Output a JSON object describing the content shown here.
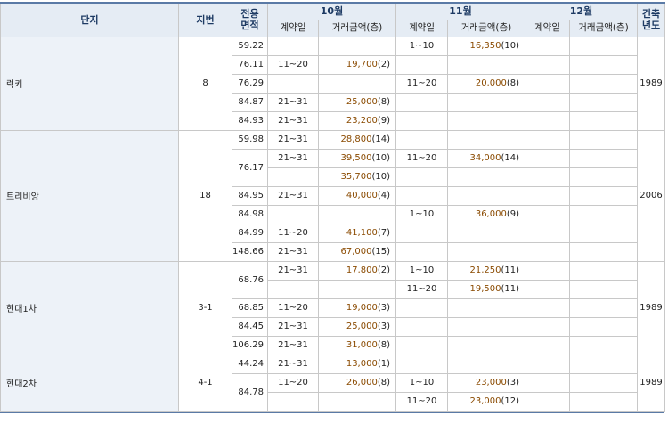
{
  "header": {
    "danji": "단지",
    "jibun": "지번",
    "area_l1": "전용",
    "area_l2": "면적",
    "months": [
      "10월",
      "11월",
      "12월"
    ],
    "built_l1": "건축",
    "built_l2": "년도",
    "contract_day": "계약일",
    "amount": "거래금액(층)"
  },
  "groups": [
    {
      "name": "럭키",
      "jibun": "8",
      "year": "1989",
      "rows": [
        {
          "area": "59.22",
          "m10d": "",
          "m10v": "",
          "m10c": "",
          "m11d": "1~10",
          "m11v": "16,350",
          "m11c": "(10)",
          "m12d": "",
          "m12v": "",
          "m12c": ""
        },
        {
          "area": "76.11",
          "m10d": "11~20",
          "m10v": "19,700",
          "m10c": "(2)",
          "m11d": "",
          "m11v": "",
          "m11c": "",
          "m12d": "",
          "m12v": "",
          "m12c": ""
        },
        {
          "area": "76.29",
          "m10d": "",
          "m10v": "",
          "m10c": "",
          "m11d": "11~20",
          "m11v": "20,000",
          "m11c": "(8)",
          "m12d": "",
          "m12v": "",
          "m12c": ""
        },
        {
          "area": "84.87",
          "m10d": "21~31",
          "m10v": "25,000",
          "m10c": "(8)",
          "m11d": "",
          "m11v": "",
          "m11c": "",
          "m12d": "",
          "m12v": "",
          "m12c": ""
        },
        {
          "area": "84.93",
          "m10d": "21~31",
          "m10v": "23,200",
          "m10c": "(9)",
          "m11d": "",
          "m11v": "",
          "m11c": "",
          "m12d": "",
          "m12v": "",
          "m12c": ""
        }
      ]
    },
    {
      "name": "트리비앙",
      "jibun": "18",
      "year": "2006",
      "rows": [
        {
          "area": "59.98",
          "m10d": "21~31",
          "m10v": "28,800",
          "m10c": "(14)",
          "m11d": "",
          "m11v": "",
          "m11c": "",
          "m12d": "",
          "m12v": "",
          "m12c": ""
        },
        {
          "area": "76.17",
          "m10d": "21~31",
          "m10v": "39,500",
          "m10c": "(10)",
          "m11d": "11~20",
          "m11v": "34,000",
          "m11c": "(14)",
          "m12d": "",
          "m12v": "",
          "m12c": ""
        },
        {
          "area": "",
          "m10d": "",
          "m10v": "35,700",
          "m10c": "(10)",
          "m11d": "",
          "m11v": "",
          "m11c": "",
          "m12d": "",
          "m12v": "",
          "m12c": ""
        },
        {
          "area": "84.95",
          "m10d": "21~31",
          "m10v": "40,000",
          "m10c": "(4)",
          "m11d": "",
          "m11v": "",
          "m11c": "",
          "m12d": "",
          "m12v": "",
          "m12c": ""
        },
        {
          "area": "84.98",
          "m10d": "",
          "m10v": "",
          "m10c": "",
          "m11d": "1~10",
          "m11v": "36,000",
          "m11c": "(9)",
          "m12d": "",
          "m12v": "",
          "m12c": ""
        },
        {
          "area": "84.99",
          "m10d": "11~20",
          "m10v": "41,100",
          "m10c": "(7)",
          "m11d": "",
          "m11v": "",
          "m11c": "",
          "m12d": "",
          "m12v": "",
          "m12c": ""
        },
        {
          "area": "148.66",
          "m10d": "21~31",
          "m10v": "67,000",
          "m10c": "(15)",
          "m11d": "",
          "m11v": "",
          "m11c": "",
          "m12d": "",
          "m12v": "",
          "m12c": ""
        }
      ]
    },
    {
      "name": "현대1차",
      "jibun": "3-1",
      "year": "1989",
      "rows": [
        {
          "area": "68.76",
          "m10d": "21~31",
          "m10v": "17,800",
          "m10c": "(2)",
          "m11d": "1~10",
          "m11v": "21,250",
          "m11c": "(11)",
          "m12d": "",
          "m12v": "",
          "m12c": ""
        },
        {
          "area": "",
          "m10d": "",
          "m10v": "",
          "m10c": "",
          "m11d": "11~20",
          "m11v": "19,500",
          "m11c": "(11)",
          "m12d": "",
          "m12v": "",
          "m12c": ""
        },
        {
          "area": "68.85",
          "m10d": "11~20",
          "m10v": "19,000",
          "m10c": "(3)",
          "m11d": "",
          "m11v": "",
          "m11c": "",
          "m12d": "",
          "m12v": "",
          "m12c": ""
        },
        {
          "area": "84.45",
          "m10d": "21~31",
          "m10v": "25,000",
          "m10c": "(3)",
          "m11d": "",
          "m11v": "",
          "m11c": "",
          "m12d": "",
          "m12v": "",
          "m12c": ""
        },
        {
          "area": "106.29",
          "m10d": "21~31",
          "m10v": "31,000",
          "m10c": "(8)",
          "m11d": "",
          "m11v": "",
          "m11c": "",
          "m12d": "",
          "m12v": "",
          "m12c": ""
        }
      ]
    },
    {
      "name": "현대2차",
      "jibun": "4-1",
      "year": "1989",
      "rows": [
        {
          "area": "44.24",
          "m10d": "21~31",
          "m10v": "13,000",
          "m10c": "(1)",
          "m11d": "",
          "m11v": "",
          "m11c": "",
          "m12d": "",
          "m12v": "",
          "m12c": ""
        },
        {
          "area": "84.78",
          "m10d": "11~20",
          "m10v": "26,000",
          "m10c": "(8)",
          "m11d": "1~10",
          "m11v": "23,000",
          "m11c": "(3)",
          "m12d": "",
          "m12v": "",
          "m12c": ""
        },
        {
          "area": "",
          "m10d": "",
          "m10v": "",
          "m10c": "",
          "m11d": "11~20",
          "m11v": "23,000",
          "m11c": "(12)",
          "m12d": "",
          "m12v": "",
          "m12c": ""
        }
      ]
    }
  ]
}
